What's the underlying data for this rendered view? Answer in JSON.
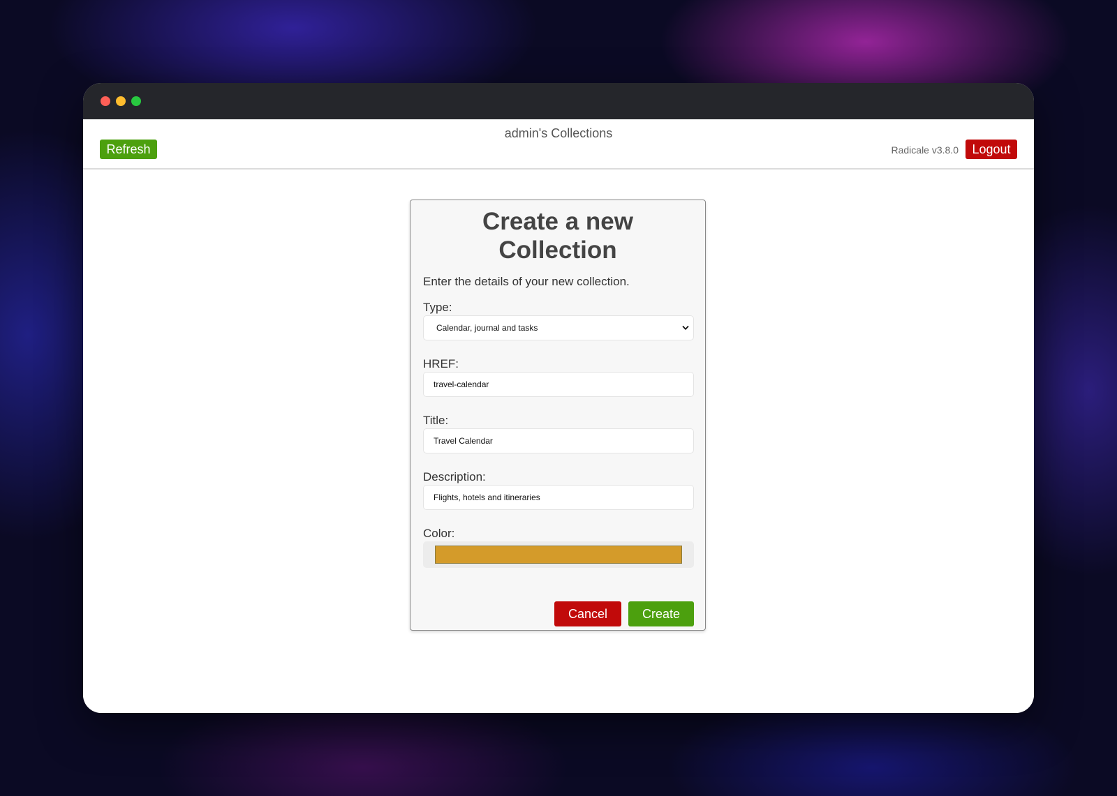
{
  "header": {
    "title": "admin's Collections",
    "refresh_label": "Refresh",
    "version": "Radicale v3.8.0",
    "logout_label": "Logout"
  },
  "dialog": {
    "title": "Create a new Collection",
    "intro": "Enter the details of your new collection.",
    "type": {
      "label": "Type:",
      "value": "Calendar, journal and tasks"
    },
    "href": {
      "label": "HREF:",
      "value": "travel-calendar"
    },
    "title_field": {
      "label": "Title:",
      "value": "Travel Calendar"
    },
    "description": {
      "label": "Description:",
      "value": "Flights, hotels and itineraries"
    },
    "color": {
      "label": "Color:",
      "value": "#d49b2a"
    },
    "cancel_label": "Cancel",
    "create_label": "Create"
  },
  "colors": {
    "green_button": "#4ca00e",
    "red_button": "#c10a0a"
  },
  "icons": {
    "select_chevron": "chevron-down-icon"
  }
}
